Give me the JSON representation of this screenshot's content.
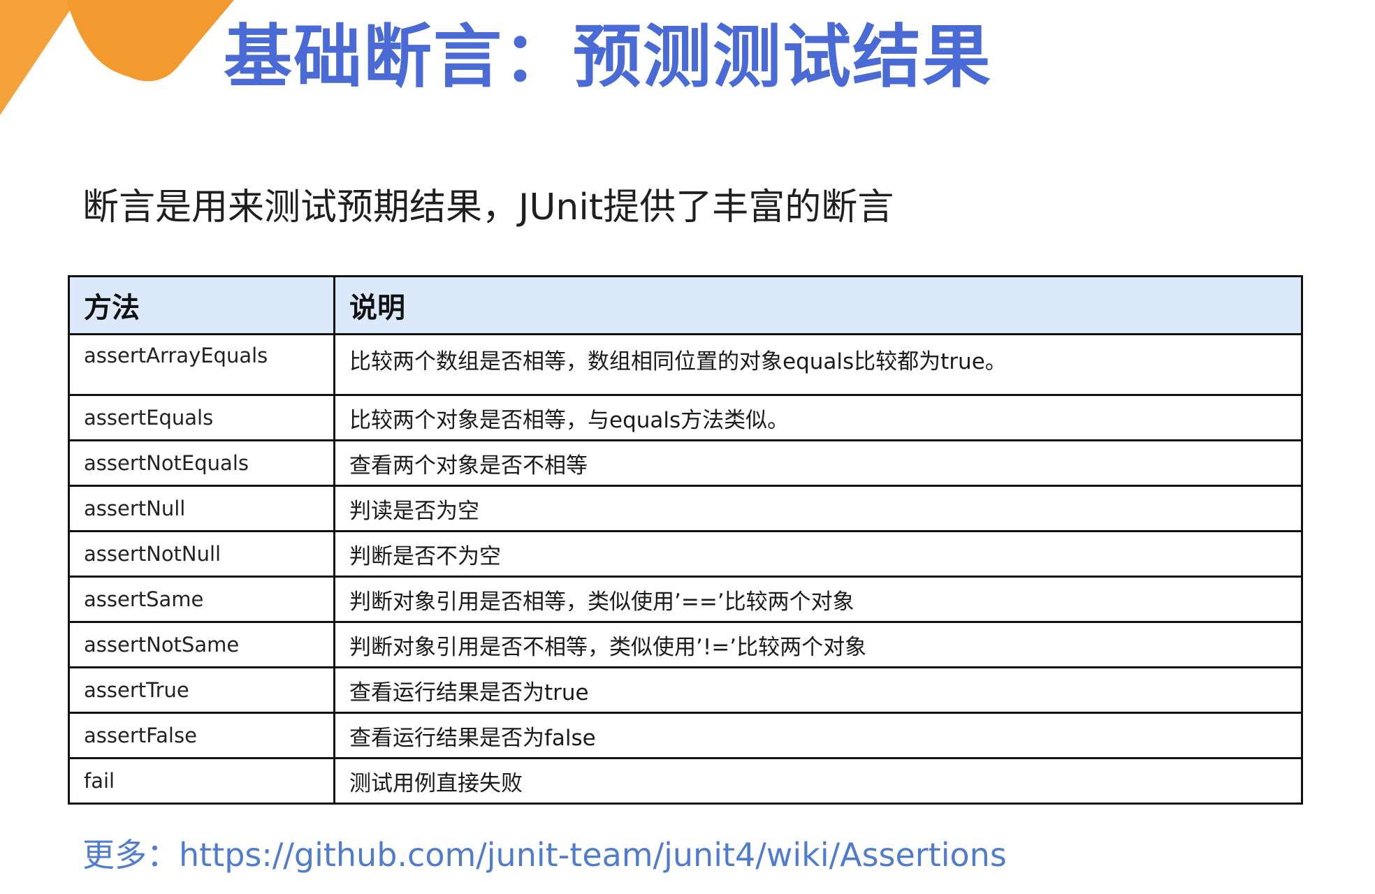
{
  "slide": {
    "title": "基础断言：预测测试结果",
    "intro": "断言是用来测试预期结果，JUnit提供了丰富的断言",
    "accent_color": "#4a6ad6",
    "decoration_color": "#f5a23a"
  },
  "table": {
    "headers": [
      "方法",
      "说明"
    ],
    "header_bg": "#dce9fb",
    "rows": [
      {
        "method": "assertArrayEquals",
        "desc": "比较两个数组是否相等，数组相同位置的对象equals比较都为true。"
      },
      {
        "method": "assertEquals",
        "desc": "比较两个对象是否相等，与equals方法类似。"
      },
      {
        "method": "assertNotEquals",
        "desc": "查看两个对象是否不相等"
      },
      {
        "method": "assertNull",
        "desc": "判读是否为空"
      },
      {
        "method": "assertNotNull",
        "desc": "判断是否不为空"
      },
      {
        "method": "assertSame",
        "desc": "判断对象引用是否相等，类似使用’==’比较两个对象"
      },
      {
        "method": "assertNotSame",
        "desc": "判断对象引用是否不相等，类似使用’!=’比较两个对象"
      },
      {
        "method": "assertTrue",
        "desc": "查看运行结果是否为true"
      },
      {
        "method": "assertFalse",
        "desc": "查看运行结果是否为false"
      },
      {
        "method": "fail",
        "desc": "测试用例直接失败"
      }
    ]
  },
  "footer": {
    "more_label": "更多：",
    "link": "https://github.com/junit-team/junit4/wiki/Assertions"
  }
}
